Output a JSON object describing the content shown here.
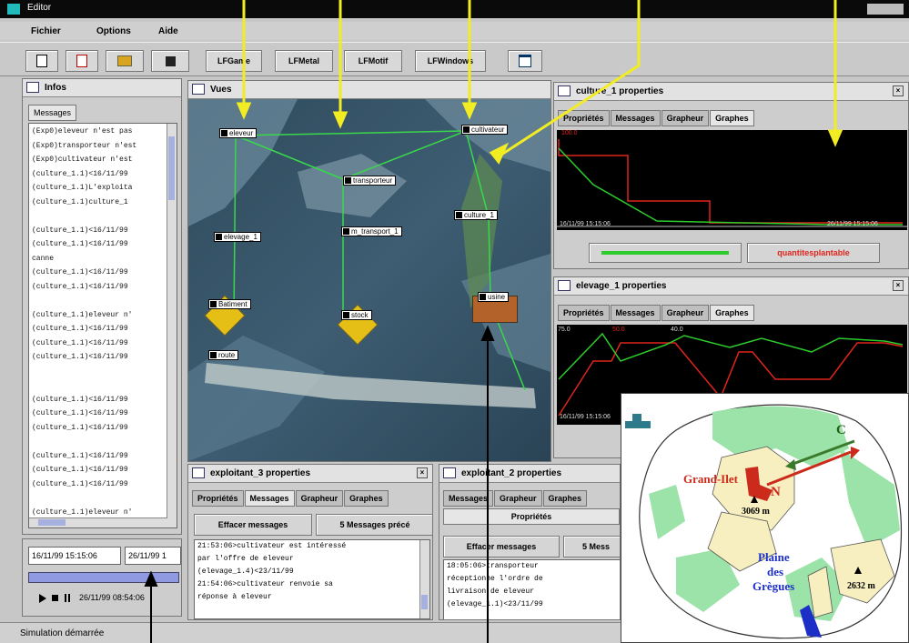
{
  "window": {
    "title": "Editor"
  },
  "menu": [
    "Fichier",
    "Options",
    "Aide"
  ],
  "toolbar": {
    "lf": [
      "LFGame",
      "LFMetal",
      "LFMotif",
      "LFWindows"
    ]
  },
  "infos": {
    "title": "Infos",
    "tab": "Messages",
    "lines": [
      "(Exp0)eleveur n'est pas",
      "(Exp0)transporteur n'est",
      "(Exp0)cultivateur n'est",
      "(culture_1.1)<16/11/99",
      "(culture_1.1)L'exploita",
      "(culture_1.1)culture_1",
      "",
      "(culture_1.1)<16/11/99",
      "(culture_1.1)<16/11/99",
      "canne",
      "(culture_1.1)<16/11/99",
      "(culture_1.1)<16/11/99",
      "",
      "(culture_1.1)eleveur n'",
      "(culture_1.1)<16/11/99",
      "(culture_1.1)<16/11/99",
      "(culture_1.1)<16/11/99",
      "",
      "",
      "(culture_1.1)<16/11/99",
      "(culture_1.1)<16/11/99",
      "(culture_1.1)<16/11/99",
      "",
      "(culture_1.1)<16/11/99",
      "(culture_1.1)<16/11/99",
      "(culture_1.1)<16/11/99",
      "",
      "(culture_1.1)eleveur n'"
    ]
  },
  "clock": {
    "start": "16/11/99 15:15:06",
    "end": "26/11/99 1",
    "current": "26/11/99 08:54:06"
  },
  "status": "Simulation démarrée",
  "vues": {
    "title": "Vues",
    "nodes": [
      "eleveur",
      "cultivateur",
      "transporteur",
      "elevage_1",
      "m_transport_1",
      "culture_1",
      "Batiment",
      "stock",
      "route",
      "usine"
    ]
  },
  "culture_props": {
    "title": "culture_1 properties",
    "tabs": [
      "Propriétés",
      "Messages",
      "Grapheur",
      "Graphes"
    ],
    "graph_start": "16/11/99 15:15:06",
    "graph_end": "26/11/99 15:15:06",
    "y_label": "100.0",
    "button_right": "quantitesplantable"
  },
  "elevage_props": {
    "title": "elevage_1 properties",
    "tabs": [
      "Propriétés",
      "Messages",
      "Grapheur",
      "Graphes"
    ],
    "y_labels": [
      "75.0",
      "50.0",
      "40.0"
    ],
    "graph_start": "16/11/99 15:15:06"
  },
  "exp3": {
    "title": "exploitant_3 properties",
    "tabs": [
      "Propriétés",
      "Messages",
      "Grapheur",
      "Graphes"
    ],
    "clear": "Effacer messages",
    "count": "5 Messages précé",
    "lines": [
      "21:53:06>cultivateur est intéressé",
      "par l'offre de eleveur",
      "(elevage_1.4)<23/11/99",
      "21:54:06>cultivateur renvoie sa",
      "réponse à eleveur"
    ]
  },
  "exp2": {
    "title": "exploitant_2 properties",
    "tabs": [
      "Messages",
      "Grapheur",
      "Graphes"
    ],
    "tab_props": "Propriétés",
    "clear": "Effacer messages",
    "count": "5 Mess",
    "lines": [
      "18:05:06>transporteur",
      "réceptionne l'ordre de",
      "livraison de eleveur",
      "(elevage_1.1)<23/11/99"
    ]
  },
  "map": {
    "labels": {
      "grand_ilet": "Grand-Ilet",
      "n": "N",
      "c": "C",
      "alt1": "3069 m",
      "plaine": [
        "Plaine",
        "des",
        "Grègues"
      ],
      "alt2": "2632 m"
    },
    "colors": {
      "green": "#9be3a8",
      "beige": "#f7efc0",
      "red": "#cc2a1a",
      "blue": "#1c2fc7"
    }
  },
  "colors": {
    "arrow": "#f2ec22",
    "link": "#39d84a",
    "graph_red": "#e0241c",
    "graph_green": "#2ccc2c"
  }
}
